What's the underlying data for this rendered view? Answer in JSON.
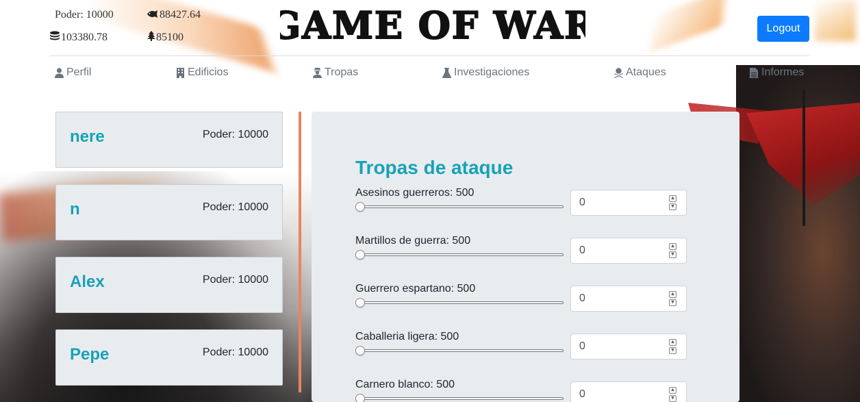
{
  "header": {
    "stats": {
      "power": "Poder: 10000",
      "fish": "88427.64",
      "coins": "103380.78",
      "wood": "85100"
    },
    "logo_text": "GAME OF WAR",
    "logout_label": "Logout"
  },
  "nav": {
    "items": [
      {
        "label": "Perfil",
        "icon": "user-icon"
      },
      {
        "label": "Edificios",
        "icon": "building-icon"
      },
      {
        "label": "Tropas",
        "icon": "soldier-icon"
      },
      {
        "label": "Investigaciones",
        "icon": "flask-icon"
      },
      {
        "label": "Ataques",
        "icon": "skull-crossbones-icon"
      },
      {
        "label": "Informes",
        "icon": "file-icon"
      }
    ]
  },
  "players": [
    {
      "name": "nere",
      "power": "Poder: 10000"
    },
    {
      "name": "n",
      "power": "Poder: 10000"
    },
    {
      "name": "Alex",
      "power": "Poder: 10000"
    },
    {
      "name": "Pepe",
      "power": "Poder: 10000"
    }
  ],
  "attack_panel": {
    "title": "Tropas de ataque",
    "troops": [
      {
        "label": "Asesinos guerreros: 500",
        "value": "0",
        "slider_fraction": 0
      },
      {
        "label": "Martillos de guerra: 500",
        "value": "0",
        "slider_fraction": 0
      },
      {
        "label": "Guerrero espartano: 500",
        "value": "0",
        "slider_fraction": 0
      },
      {
        "label": "Caballeria ligera: 500",
        "value": "0",
        "slider_fraction": 0
      },
      {
        "label": "Carnero blanco: 500",
        "value": "0",
        "slider_fraction": 0
      }
    ]
  },
  "colors": {
    "accent": "#17a2b8",
    "logout": "#0d7bff",
    "divider": "#e8865a",
    "panel_bg": "#e9ecef"
  }
}
